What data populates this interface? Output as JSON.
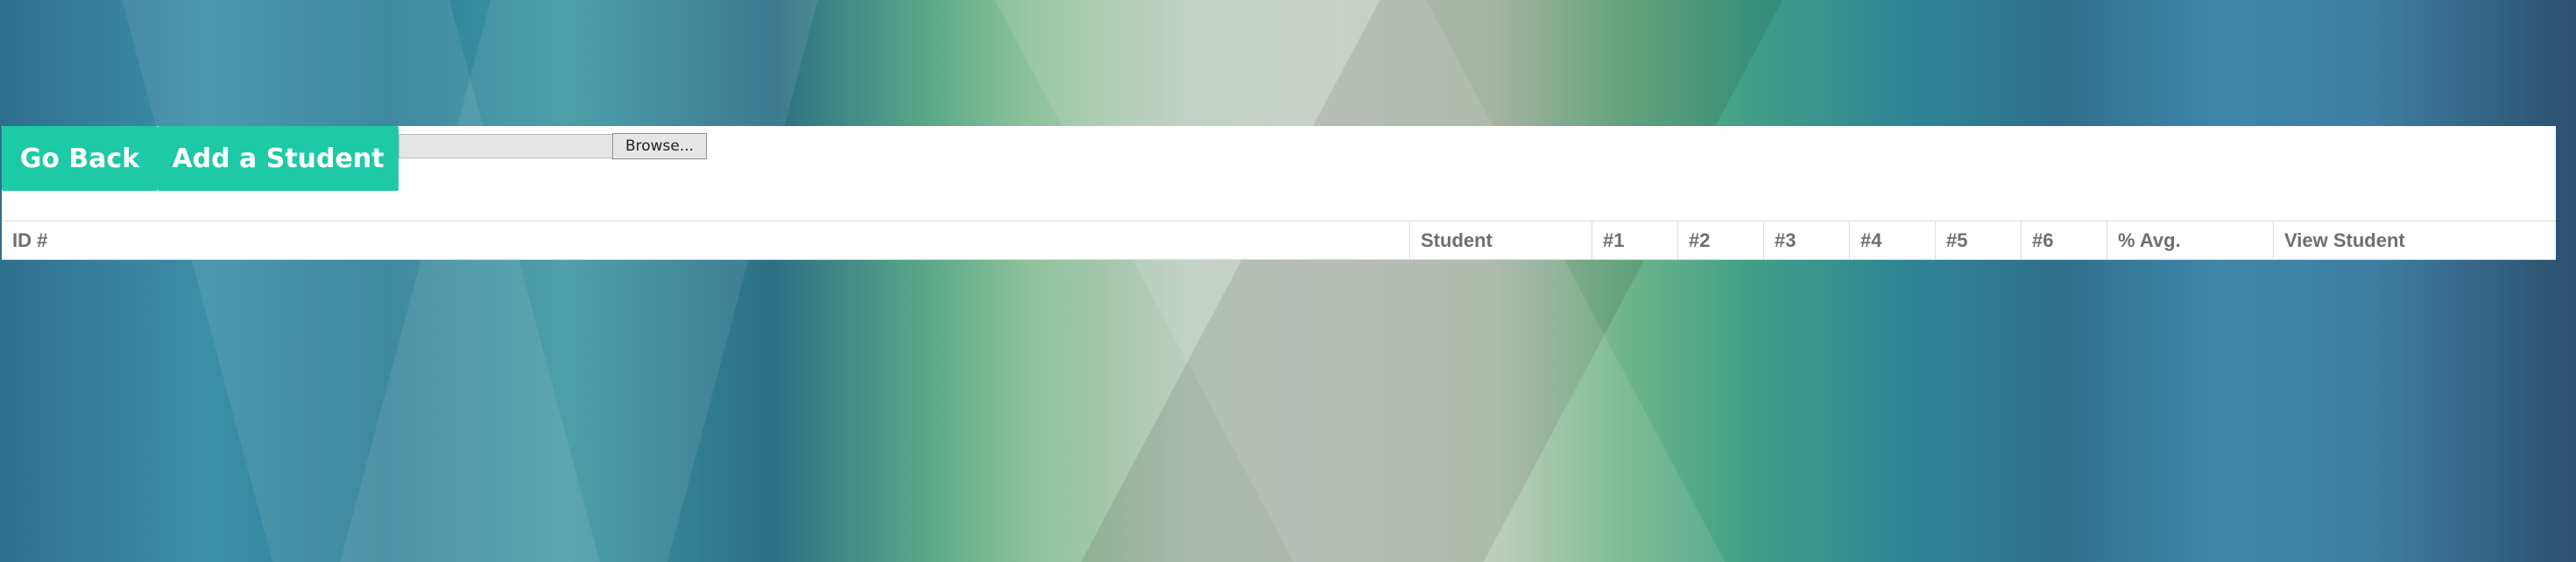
{
  "buttons": {
    "go_back": "Go Back",
    "add_student": "Add a Student"
  },
  "file_input": {
    "browse_label": "Browse..."
  },
  "table": {
    "headers": [
      "ID #",
      "Student",
      "#1",
      "#2",
      "#3",
      "#4",
      "#5",
      "#6",
      "% Avg.",
      "View Student"
    ]
  },
  "colors": {
    "accent": "#1ec9a7"
  }
}
